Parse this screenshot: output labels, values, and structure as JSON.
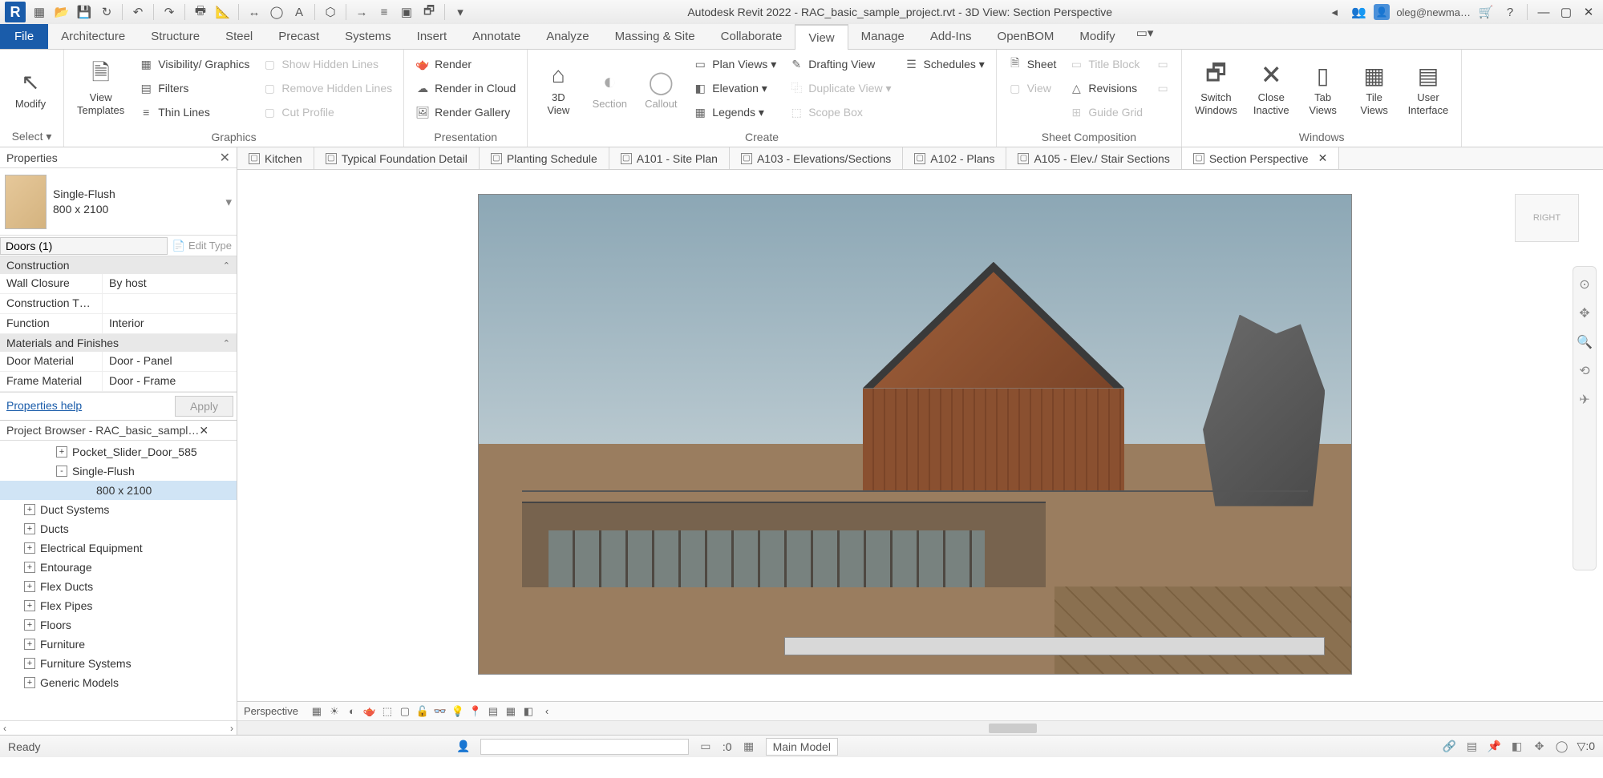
{
  "title": "Autodesk Revit 2022 - RAC_basic_sample_project.rvt - 3D View: Section Perspective",
  "user": "oleg@newma…",
  "ribbon_tabs": [
    "Architecture",
    "Structure",
    "Steel",
    "Precast",
    "Systems",
    "Insert",
    "Annotate",
    "Analyze",
    "Massing & Site",
    "Collaborate",
    "View",
    "Manage",
    "Add-Ins",
    "OpenBOM",
    "Modify"
  ],
  "active_tab": "View",
  "ribbon": {
    "select": {
      "modify": "Modify",
      "templates": "View\nTemplates",
      "title": "Select ▾"
    },
    "graphics": {
      "vis": "Visibility/  Graphics",
      "filters": "Filters",
      "thin": "Thin  Lines",
      "show": "Show  Hidden Lines",
      "remove": "Remove  Hidden Lines",
      "cut": "Cut  Profile",
      "title": "Graphics"
    },
    "presentation": {
      "render": "Render",
      "cloud": "Render  in Cloud",
      "gallery": "Render  Gallery",
      "title": "Presentation"
    },
    "create": {
      "view3d": "3D\nView",
      "section": "Section",
      "callout": "Callout",
      "plan": "Plan  Views ▾",
      "elev": "Elevation  ▾",
      "legends": "Legends ▾",
      "draft": "Drafting  View",
      "dup": "Duplicate  View ▾",
      "scope": "Scope  Box",
      "sched": "Schedules ▾",
      "title": "Create"
    },
    "sheet": {
      "sheet": "Sheet",
      "titleb": "Title  Block",
      "rev": "Revisions",
      "guide": "Guide  Grid",
      "view": "View",
      "matchline": "",
      "vref": "",
      "title": "Sheet Composition"
    },
    "windows": {
      "switch": "Switch\nWindows",
      "close": "Close\nInactive",
      "tabv": "Tab\nViews",
      "tile": "Tile\nViews",
      "ui": "User\nInterface",
      "title": "Windows"
    }
  },
  "properties": {
    "title": "Properties",
    "type_name": "Single-Flush",
    "type_size": "800 x 2100",
    "filter": "Doors (1)",
    "edit_type": "Edit Type",
    "groups": [
      {
        "name": "Construction",
        "rows": [
          {
            "n": "Wall Closure",
            "v": "By host"
          },
          {
            "n": "Construction T…",
            "v": ""
          },
          {
            "n": "Function",
            "v": "Interior"
          }
        ]
      },
      {
        "name": "Materials and Finishes",
        "rows": [
          {
            "n": "Door Material",
            "v": "Door - Panel"
          },
          {
            "n": "Frame Material",
            "v": "Door - Frame"
          }
        ]
      }
    ],
    "help": "Properties help",
    "apply": "Apply"
  },
  "browser": {
    "title": "Project Browser - RAC_basic_sampl…",
    "tree": [
      {
        "lvl": 1,
        "exp": "+",
        "label": "Pocket_Slider_Door_585"
      },
      {
        "lvl": 1,
        "exp": "-",
        "label": "Single-Flush"
      },
      {
        "lvl": 3,
        "exp": "",
        "label": "800 x 2100",
        "sel": true
      },
      {
        "lvl": 0,
        "exp": "+",
        "label": "Duct Systems"
      },
      {
        "lvl": 0,
        "exp": "+",
        "label": "Ducts"
      },
      {
        "lvl": 0,
        "exp": "+",
        "label": "Electrical Equipment"
      },
      {
        "lvl": 0,
        "exp": "+",
        "label": "Entourage"
      },
      {
        "lvl": 0,
        "exp": "+",
        "label": "Flex Ducts"
      },
      {
        "lvl": 0,
        "exp": "+",
        "label": "Flex Pipes"
      },
      {
        "lvl": 0,
        "exp": "+",
        "label": "Floors"
      },
      {
        "lvl": 0,
        "exp": "+",
        "label": "Furniture"
      },
      {
        "lvl": 0,
        "exp": "+",
        "label": "Furniture Systems"
      },
      {
        "lvl": 0,
        "exp": "+",
        "label": "Generic Models"
      }
    ]
  },
  "view_tabs": [
    {
      "label": "Kitchen"
    },
    {
      "label": "Typical Foundation Detail"
    },
    {
      "label": "Planting Schedule"
    },
    {
      "label": "A101 - Site Plan"
    },
    {
      "label": "A103 - Elevations/Sections"
    },
    {
      "label": "A102 - Plans"
    },
    {
      "label": "A105 - Elev./ Stair Sections"
    },
    {
      "label": "Section Perspective",
      "active": true,
      "close": true
    }
  ],
  "view_cube": "RIGHT",
  "view_ctrl": {
    "mode": "Perspective"
  },
  "status": {
    "ready": "Ready",
    "zero": ":0",
    "model": "Main Model",
    "filter_count": "▽:0"
  }
}
